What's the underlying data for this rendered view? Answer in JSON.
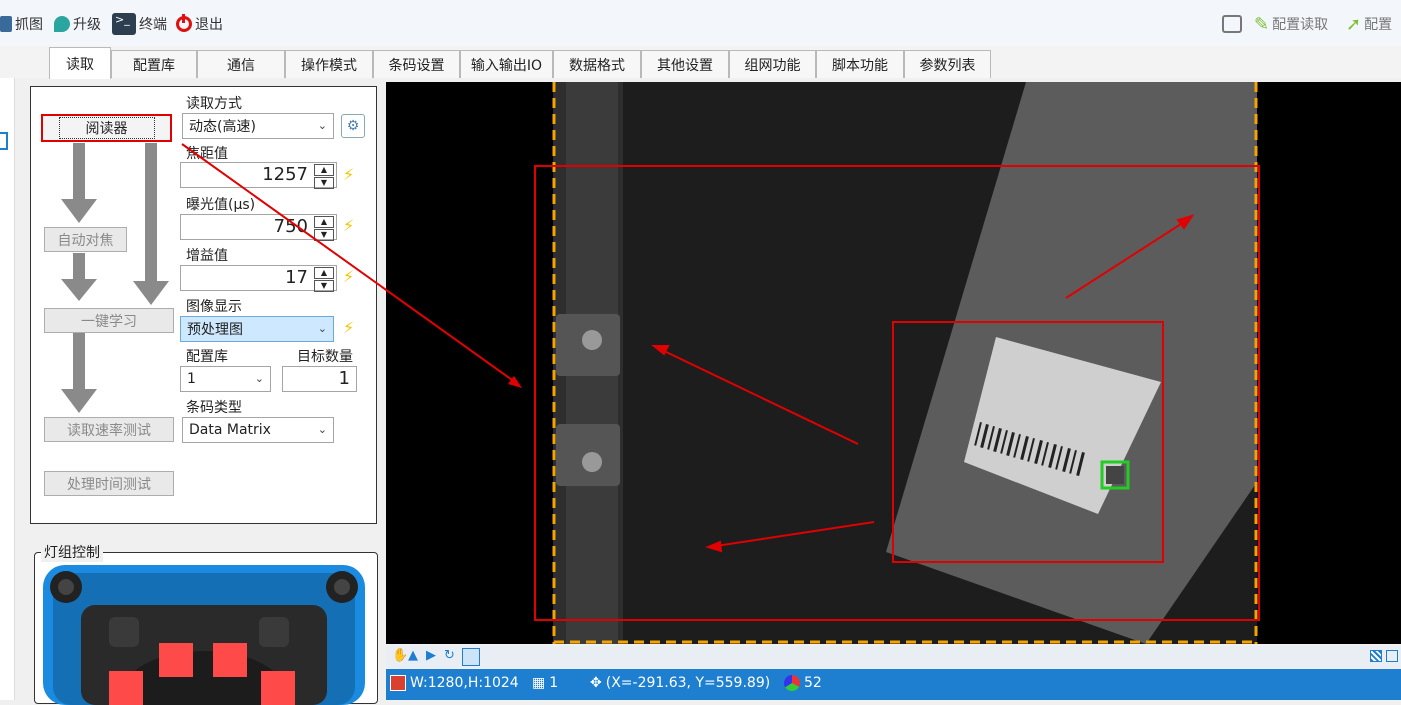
{
  "toolbar": {
    "capture": "抓图",
    "upgrade": "升级",
    "terminal": "终端",
    "exit": "退出",
    "config_read": "配置读取",
    "config_write": "配置"
  },
  "tabs": [
    {
      "label": "读取",
      "active": true
    },
    {
      "label": "配置库"
    },
    {
      "label": "通信"
    },
    {
      "label": "操作模式"
    },
    {
      "label": "条码设置"
    },
    {
      "label": "输入输出IO"
    },
    {
      "label": "数据格式"
    },
    {
      "label": "其他设置"
    },
    {
      "label": "组网功能"
    },
    {
      "label": "脚本功能"
    },
    {
      "label": "参数列表"
    }
  ],
  "panel": {
    "reader_button": "阅读器",
    "autofocus_button": "自动对焦",
    "learn_button": "一键学习",
    "read_rate_button": "读取速率测试",
    "process_time_button": "处理时间测试",
    "read_mode_label": "读取方式",
    "read_mode_value": "动态(高速)",
    "focus_label": "焦距值",
    "focus_value": "1257",
    "exposure_label": "曝光值(µs)",
    "exposure_value": "750",
    "gain_label": "增益值",
    "gain_value": "17",
    "image_display_label": "图像显示",
    "image_display_value": "预处理图",
    "config_lib_label": "配置库",
    "config_lib_value": "1",
    "target_count_label": "目标数量",
    "target_count_value": "1",
    "code_type_label": "条码类型",
    "code_type_value": "Data Matrix"
  },
  "light_group": {
    "title": "灯组控制"
  },
  "status": {
    "size": "W:1280,H:1024",
    "count": "1",
    "coords": "(X=-291.63, Y=559.89)",
    "color_value": "52"
  },
  "colors": {
    "status_bar": "#1e7fd1",
    "highlight": "#e00000",
    "roi_dash": "#f5a300",
    "bolt": "#f2c500"
  }
}
